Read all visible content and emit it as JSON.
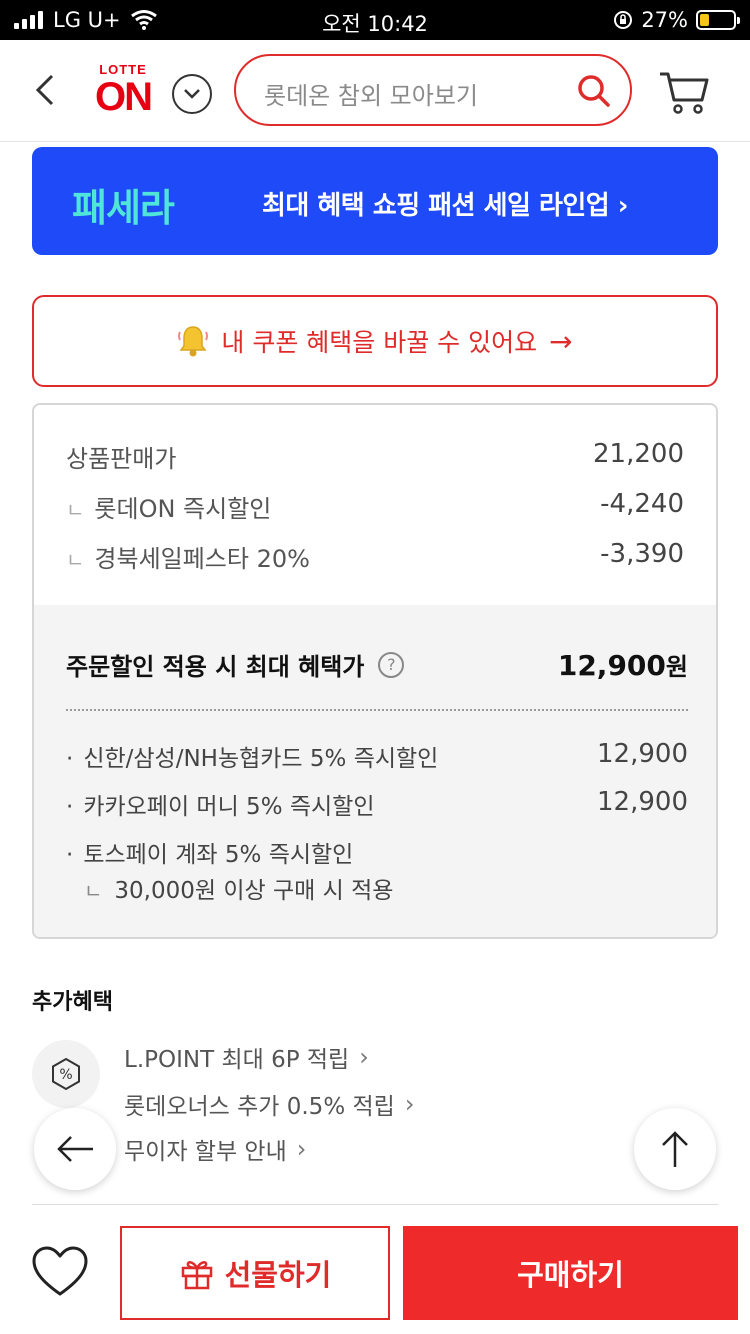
{
  "status_bar": {
    "carrier": "LG U+",
    "time": "오전 10:42",
    "battery": "27%",
    "battery_level": 0.27
  },
  "header": {
    "logo_top": "LOTTE",
    "logo_main": "ON",
    "search_placeholder": "롯데온 참외 모아보기"
  },
  "banner": {
    "brand": "패세라",
    "text": "최대 혜택 쇼핑 패션 세일 라인업 ›"
  },
  "coupon": {
    "label": "내 쿠폰 혜택을 바꿀 수 있어요",
    "arrow": "→"
  },
  "price": {
    "rows": [
      {
        "label": "상품판매가",
        "value": "21,200"
      },
      {
        "label": "롯데ON 즉시할인",
        "value": "-4,240"
      },
      {
        "label": "경북세일페스타 20%",
        "value": "-3,390"
      }
    ],
    "sub_mark": "ㄴ",
    "best_label": "주문할인 적용 시 최대 혜택가",
    "best_value": "12,900",
    "best_unit": "원",
    "cards": [
      {
        "label": "신한/삼성/NH농협카드 5% 즉시할인",
        "value": "12,900"
      },
      {
        "label": "카카오페이 머니 5% 즉시할인",
        "value": "12,900"
      },
      {
        "label": "토스페이 계좌 5% 즉시할인",
        "value": ""
      }
    ],
    "card_note": "30,000원 이상 구매 시 적용",
    "bullet": "·"
  },
  "extra": {
    "title": "추가혜택",
    "items": [
      {
        "label": "L.POINT 최대 6P 적립"
      },
      {
        "label": "롯데오너스 추가 0.5% 적립"
      },
      {
        "label": "무이자 할부 안내"
      }
    ],
    "chevron": "›"
  },
  "bottom": {
    "gift_label": "선물하기",
    "buy_label": "구매하기"
  },
  "colors": {
    "accent": "#e02b2b",
    "banner_bg": "#1e4bf7",
    "banner_brand": "#4fe6d9",
    "buy_bg": "#ee2a2a"
  }
}
